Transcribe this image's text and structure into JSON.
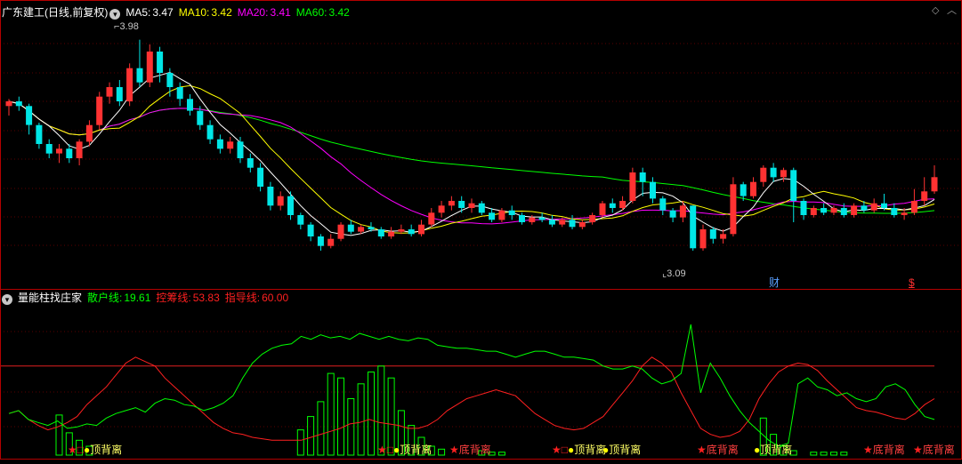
{
  "main_panel": {
    "title": "广东建工(日线,前复权)",
    "ma5": {
      "label": "MA5:",
      "value": "3.47",
      "color": "#ffffff"
    },
    "ma10": {
      "label": "MA10:",
      "value": "3.42",
      "color": "#ffff00"
    },
    "ma20": {
      "label": "MA20:",
      "value": "3.41",
      "color": "#ff00ff"
    },
    "ma60": {
      "label": "MA60:",
      "value": "3.42",
      "color": "#00ff00"
    },
    "high_marker": "3.98",
    "low_marker": "3.09",
    "event_cai": "财",
    "event_s": "$",
    "corner_icons": [
      "diamond-icon",
      "chevron-up-icon"
    ]
  },
  "indicator_panel": {
    "title": "量能柱找庄家",
    "sanhu": {
      "label": "散户线:",
      "value": "19.61",
      "color": "#00ff00"
    },
    "kongchou": {
      "label": "控筹线:",
      "value": "53.83",
      "color": "#ff2020"
    },
    "zhidao": {
      "label": "指导线:",
      "value": "60.00",
      "color": "#ff2020"
    },
    "signals": [
      {
        "kind": "top",
        "text": "顶背离"
      },
      {
        "kind": "top",
        "text": "顶背离"
      },
      {
        "kind": "bottom",
        "text": "底背离"
      },
      {
        "kind": "top",
        "text": "顶背离"
      },
      {
        "kind": "top",
        "text": "顶背离"
      },
      {
        "kind": "bottom",
        "text": "底背离"
      },
      {
        "kind": "top",
        "text": "顶背离"
      },
      {
        "kind": "bottom",
        "text": "底背离"
      },
      {
        "kind": "bottom",
        "text": "底背离"
      }
    ]
  },
  "chart_data": {
    "type": "candlestick",
    "price_range": [
      3.0,
      4.05
    ],
    "candles": [
      [
        3.7,
        3.72,
        3.66,
        3.73
      ],
      [
        3.72,
        3.7,
        3.68,
        3.74
      ],
      [
        3.7,
        3.62,
        3.58,
        3.71
      ],
      [
        3.62,
        3.54,
        3.52,
        3.63
      ],
      [
        3.54,
        3.5,
        3.48,
        3.56
      ],
      [
        3.5,
        3.52,
        3.46,
        3.54
      ],
      [
        3.52,
        3.48,
        3.46,
        3.54
      ],
      [
        3.48,
        3.55,
        3.45,
        3.56
      ],
      [
        3.55,
        3.62,
        3.53,
        3.64
      ],
      [
        3.62,
        3.74,
        3.6,
        3.76
      ],
      [
        3.74,
        3.78,
        3.71,
        3.8
      ],
      [
        3.78,
        3.72,
        3.7,
        3.81
      ],
      [
        3.72,
        3.86,
        3.7,
        3.88
      ],
      [
        3.86,
        3.8,
        3.78,
        3.98
      ],
      [
        3.8,
        3.93,
        3.78,
        3.96
      ],
      [
        3.93,
        3.84,
        3.8,
        3.95
      ],
      [
        3.84,
        3.78,
        3.74,
        3.86
      ],
      [
        3.78,
        3.73,
        3.7,
        3.8
      ],
      [
        3.73,
        3.68,
        3.66,
        3.75
      ],
      [
        3.68,
        3.62,
        3.6,
        3.7
      ],
      [
        3.62,
        3.56,
        3.54,
        3.64
      ],
      [
        3.56,
        3.52,
        3.5,
        3.58
      ],
      [
        3.52,
        3.55,
        3.5,
        3.57
      ],
      [
        3.55,
        3.48,
        3.46,
        3.57
      ],
      [
        3.48,
        3.44,
        3.42,
        3.5
      ],
      [
        3.44,
        3.36,
        3.34,
        3.46
      ],
      [
        3.36,
        3.28,
        3.26,
        3.38
      ],
      [
        3.28,
        3.32,
        3.26,
        3.34
      ],
      [
        3.32,
        3.24,
        3.22,
        3.34
      ],
      [
        3.24,
        3.2,
        3.18,
        3.25
      ],
      [
        3.2,
        3.15,
        3.13,
        3.21
      ],
      [
        3.15,
        3.11,
        3.09,
        3.16
      ],
      [
        3.11,
        3.14,
        3.1,
        3.16
      ],
      [
        3.14,
        3.2,
        3.13,
        3.21
      ],
      [
        3.2,
        3.17,
        3.16,
        3.22
      ],
      [
        3.17,
        3.19,
        3.16,
        3.2
      ],
      [
        3.19,
        3.18,
        3.17,
        3.21
      ],
      [
        3.18,
        3.15,
        3.14,
        3.19
      ],
      [
        3.15,
        3.17,
        3.14,
        3.19
      ],
      [
        3.17,
        3.18,
        3.16,
        3.2
      ],
      [
        3.18,
        3.16,
        3.15,
        3.2
      ],
      [
        3.16,
        3.2,
        3.15,
        3.22
      ],
      [
        3.2,
        3.25,
        3.19,
        3.27
      ],
      [
        3.25,
        3.28,
        3.23,
        3.3
      ],
      [
        3.28,
        3.3,
        3.26,
        3.32
      ],
      [
        3.3,
        3.27,
        3.25,
        3.32
      ],
      [
        3.27,
        3.29,
        3.25,
        3.31
      ],
      [
        3.29,
        3.25,
        3.24,
        3.3
      ],
      [
        3.25,
        3.22,
        3.21,
        3.27
      ],
      [
        3.22,
        3.26,
        3.21,
        3.27
      ],
      [
        3.26,
        3.24,
        3.22,
        3.28
      ],
      [
        3.24,
        3.21,
        3.2,
        3.25
      ],
      [
        3.21,
        3.23,
        3.2,
        3.24
      ],
      [
        3.23,
        3.22,
        3.21,
        3.25
      ],
      [
        3.22,
        3.2,
        3.19,
        3.24
      ],
      [
        3.2,
        3.22,
        3.19,
        3.23
      ],
      [
        3.22,
        3.19,
        3.18,
        3.24
      ],
      [
        3.19,
        3.21,
        3.18,
        3.22
      ],
      [
        3.21,
        3.24,
        3.2,
        3.25
      ],
      [
        3.24,
        3.29,
        3.23,
        3.3
      ],
      [
        3.29,
        3.27,
        3.25,
        3.31
      ],
      [
        3.27,
        3.3,
        3.26,
        3.32
      ],
      [
        3.3,
        3.42,
        3.29,
        3.44
      ],
      [
        3.42,
        3.38,
        3.32,
        3.44
      ],
      [
        3.38,
        3.31,
        3.29,
        3.4
      ],
      [
        3.31,
        3.26,
        3.24,
        3.32
      ],
      [
        3.26,
        3.23,
        3.21,
        3.27
      ],
      [
        3.23,
        3.28,
        3.21,
        3.3
      ],
      [
        3.28,
        3.1,
        3.09,
        3.28
      ],
      [
        3.1,
        3.18,
        3.09,
        3.2
      ],
      [
        3.18,
        3.14,
        3.12,
        3.19
      ],
      [
        3.14,
        3.16,
        3.12,
        3.18
      ],
      [
        3.16,
        3.37,
        3.15,
        3.4
      ],
      [
        3.37,
        3.32,
        3.3,
        3.38
      ],
      [
        3.32,
        3.38,
        3.31,
        3.4
      ],
      [
        3.38,
        3.44,
        3.36,
        3.45
      ],
      [
        3.44,
        3.4,
        3.38,
        3.46
      ],
      [
        3.4,
        3.43,
        3.38,
        3.44
      ],
      [
        3.43,
        3.3,
        3.21,
        3.44
      ],
      [
        3.3,
        3.24,
        3.22,
        3.31
      ],
      [
        3.24,
        3.27,
        3.23,
        3.28
      ],
      [
        3.27,
        3.25,
        3.24,
        3.29
      ],
      [
        3.25,
        3.27,
        3.24,
        3.28
      ],
      [
        3.27,
        3.24,
        3.23,
        3.29
      ],
      [
        3.24,
        3.28,
        3.23,
        3.29
      ],
      [
        3.28,
        3.26,
        3.25,
        3.3
      ],
      [
        3.26,
        3.29,
        3.25,
        3.31
      ],
      [
        3.29,
        3.27,
        3.26,
        3.33
      ],
      [
        3.27,
        3.24,
        3.23,
        3.29
      ],
      [
        3.24,
        3.25,
        3.22,
        3.27
      ],
      [
        3.25,
        3.3,
        3.24,
        3.35
      ],
      [
        3.3,
        3.34,
        3.28,
        3.4
      ],
      [
        3.34,
        3.4,
        3.33,
        3.45
      ]
    ],
    "indicator_range": [
      0,
      100
    ],
    "sanhu_line": [
      28,
      30,
      24,
      22,
      20,
      23,
      18,
      19,
      21,
      20,
      25,
      28,
      30,
      32,
      29,
      35,
      38,
      37,
      34,
      33,
      30,
      32,
      35,
      40,
      52,
      62,
      68,
      72,
      74,
      75,
      80,
      78,
      81,
      79,
      80,
      78,
      82,
      80,
      78,
      80,
      78,
      77,
      79,
      78,
      74,
      73,
      72,
      72,
      71,
      70,
      70,
      68,
      66,
      68,
      70,
      70,
      68,
      66,
      66,
      65,
      64,
      60,
      58,
      58,
      60,
      58,
      52,
      48,
      50,
      55,
      88,
      42,
      62,
      52,
      40,
      30,
      22,
      16,
      10,
      6,
      8,
      48,
      52,
      46,
      44,
      40,
      42,
      38,
      36,
      38,
      46,
      48,
      44,
      34,
      26,
      24
    ],
    "kongchou_line": [
      28,
      30,
      24,
      20,
      17,
      19,
      22,
      26,
      34,
      40,
      46,
      54,
      62,
      66,
      63,
      60,
      52,
      46,
      40,
      34,
      28,
      22,
      18,
      15,
      14,
      12,
      11,
      10,
      10,
      10,
      10,
      12,
      14,
      16,
      18,
      21,
      22,
      24,
      22,
      21,
      20,
      18,
      18,
      20,
      24,
      30,
      34,
      38,
      40,
      42,
      44,
      42,
      40,
      34,
      28,
      24,
      20,
      18,
      17,
      18,
      22,
      26,
      34,
      42,
      50,
      60,
      66,
      62,
      56,
      42,
      30,
      18,
      14,
      12,
      13,
      16,
      24,
      38,
      48,
      56,
      60,
      62,
      61,
      57,
      50,
      44,
      38,
      32,
      30,
      29,
      27,
      25,
      24,
      28,
      34,
      38
    ],
    "zhidao_line": 60,
    "volume_bars": [
      {
        "i": 5,
        "v": 27
      },
      {
        "i": 6,
        "v": 15
      },
      {
        "i": 7,
        "v": 10
      },
      {
        "i": 8,
        "v": 6
      },
      {
        "i": 29,
        "v": 17
      },
      {
        "i": 30,
        "v": 26
      },
      {
        "i": 31,
        "v": 36
      },
      {
        "i": 32,
        "v": 55
      },
      {
        "i": 33,
        "v": 52
      },
      {
        "i": 34,
        "v": 38
      },
      {
        "i": 35,
        "v": 48
      },
      {
        "i": 36,
        "v": 56
      },
      {
        "i": 37,
        "v": 60
      },
      {
        "i": 38,
        "v": 52
      },
      {
        "i": 39,
        "v": 30
      },
      {
        "i": 40,
        "v": 20
      },
      {
        "i": 41,
        "v": 12
      },
      {
        "i": 42,
        "v": 6
      },
      {
        "i": 43,
        "v": 4
      },
      {
        "i": 47,
        "v": 3
      },
      {
        "i": 48,
        "v": 2
      },
      {
        "i": 49,
        "v": 2
      },
      {
        "i": 75,
        "v": 25
      },
      {
        "i": 76,
        "v": 14
      },
      {
        "i": 77,
        "v": 6
      },
      {
        "i": 78,
        "v": 3
      },
      {
        "i": 80,
        "v": 2
      },
      {
        "i": 81,
        "v": 2
      },
      {
        "i": 82,
        "v": 2
      },
      {
        "i": 83,
        "v": 2
      }
    ]
  }
}
